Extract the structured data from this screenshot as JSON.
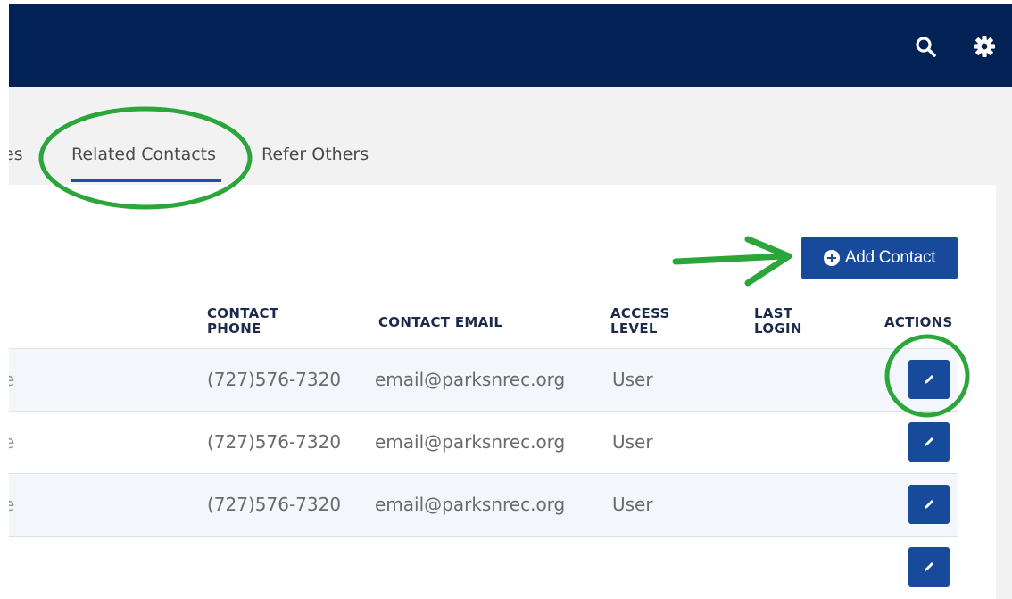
{
  "tabs": {
    "partial_label": "es",
    "related_contacts": "Related Contacts",
    "refer_others": "Refer Others"
  },
  "actions": {
    "add_contact": "Add Contact"
  },
  "table": {
    "headers": {
      "phone": "CONTACT\nPHONE",
      "email": "CONTACT EMAIL",
      "access": "ACCESS\nLEVEL",
      "last_login": "LAST\nLOGIN",
      "actions": "ACTIONS"
    },
    "rows": [
      {
        "partial": "e",
        "phone": "(727)576-7320",
        "email": "email@parksnrec.org",
        "access": "User",
        "last_login": ""
      },
      {
        "partial": "e",
        "phone": "(727)576-7320",
        "email": "email@parksnrec.org",
        "access": "User",
        "last_login": ""
      },
      {
        "partial": "e",
        "phone": "(727)576-7320",
        "email": "email@parksnrec.org",
        "access": "User",
        "last_login": ""
      },
      {
        "partial": "",
        "phone": "",
        "email": "",
        "access": "",
        "last_login": ""
      }
    ]
  },
  "icons": {
    "search": "search-icon",
    "settings": "gear-icon",
    "add": "plus-circle-icon",
    "edit": "pencil-icon"
  },
  "colors": {
    "header_bg": "#022154",
    "button_bg": "#184a9c",
    "annotation": "#2aa63a"
  }
}
